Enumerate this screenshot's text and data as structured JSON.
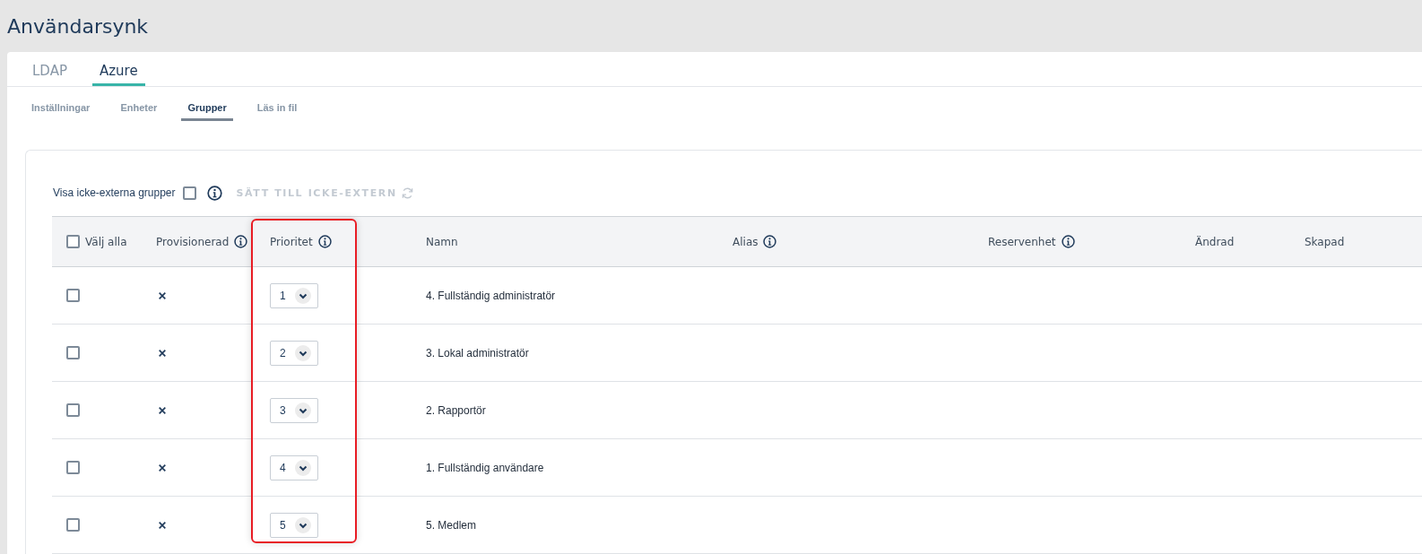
{
  "page_title": "Användarsynk",
  "tabs": [
    {
      "label": "LDAP",
      "selected": false
    },
    {
      "label": "Azure",
      "selected": true
    }
  ],
  "subtabs": [
    {
      "label": "Inställningar",
      "selected": false
    },
    {
      "label": "Enheter",
      "selected": false
    },
    {
      "label": "Grupper",
      "selected": true
    },
    {
      "label": "Läs in fil",
      "selected": false
    }
  ],
  "toolbar": {
    "show_non_external": {
      "label": "Visa icke-externa grupper",
      "checked": false
    },
    "set_non_external_button": {
      "label": "SÄTT TILL ICKE-EXTERN",
      "disabled": true
    }
  },
  "table": {
    "select_all": {
      "label": "Välj alla",
      "checked": false
    },
    "columns": [
      {
        "label": "Provisionerad",
        "info": true,
        "highlighted": false
      },
      {
        "label": "Prioritet",
        "info": true,
        "highlighted": true
      },
      {
        "label": "Namn",
        "info": false,
        "highlighted": false
      },
      {
        "label": "Alias",
        "info": true,
        "highlighted": false
      },
      {
        "label": "Reservenhet",
        "info": true,
        "highlighted": false
      },
      {
        "label": "Ändrad",
        "info": false,
        "highlighted": false
      },
      {
        "label": "Skapad",
        "info": false,
        "highlighted": false
      }
    ],
    "rows": [
      {
        "checked": false,
        "provisioned": false,
        "priority": "1",
        "name": "4. Fullständig administratör"
      },
      {
        "checked": false,
        "provisioned": false,
        "priority": "2",
        "name": "3. Lokal administratör"
      },
      {
        "checked": false,
        "provisioned": false,
        "priority": "3",
        "name": "2. Rapportör"
      },
      {
        "checked": false,
        "provisioned": false,
        "priority": "4",
        "name": "1. Fullständig användare"
      },
      {
        "checked": false,
        "provisioned": false,
        "priority": "5",
        "name": "5. Medlem"
      }
    ]
  }
}
